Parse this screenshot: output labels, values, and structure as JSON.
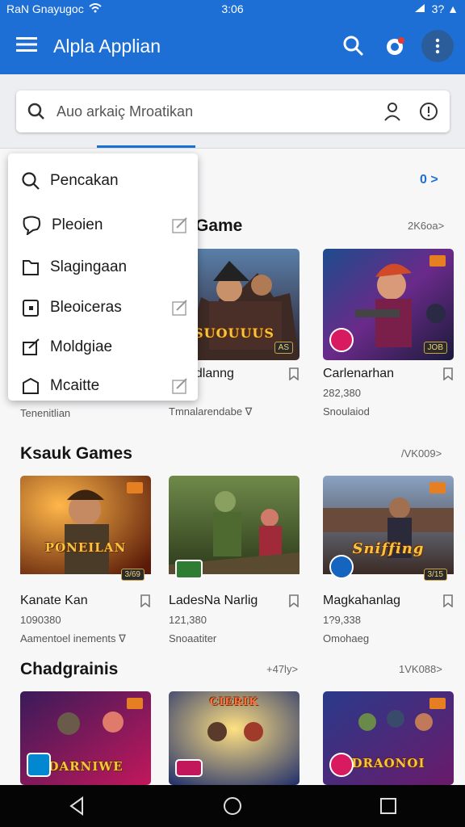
{
  "status_bar": {
    "left_text": "RaN Gnayugoc",
    "time": "3:06",
    "right_text": "3? ▲"
  },
  "app_bar": {
    "title": "Alpla Applian",
    "icons": [
      "menu-icon",
      "search-icon",
      "notification-icon",
      "more-vert-icon"
    ]
  },
  "search": {
    "placeholder": "Auo arkaiç Mroatikan"
  },
  "dropdown": {
    "items": [
      {
        "label": "Pencakan",
        "icon": "search-icon",
        "check": false
      },
      {
        "label": "Pleoien",
        "icon": "chat-icon",
        "check": true
      },
      {
        "label": "Slagingaan",
        "icon": "folder-icon",
        "check": false
      },
      {
        "label": "Bleoiceras",
        "icon": "wallet-icon",
        "check": true
      },
      {
        "label": "Moldgiae",
        "icon": "edit-box-icon",
        "check": false
      },
      {
        "label": "Mcaitte",
        "icon": "tag-icon",
        "check": true
      }
    ]
  },
  "sections": [
    {
      "title": "Game",
      "top_more": "0 >",
      "link": "2K6oa>",
      "cards": [
        {
          "name": "",
          "meta": "",
          "sub": "Tenenitlian",
          "logo": ""
        },
        {
          "name": "Smadlanng",
          "meta": "5ia",
          "sub": "Tmnalarendabe ∇",
          "logo": "SUOUUUS",
          "badge": "AS"
        },
        {
          "name": "Carlenarhan",
          "meta": "282,380",
          "sub": "Snoulaiod",
          "logo": "",
          "badge": "JOB"
        }
      ]
    },
    {
      "title": "Ksauk Games",
      "link": "/VK009>",
      "cards": [
        {
          "name": "Kanate Kan",
          "meta": "1090380",
          "sub": "Aamentoel inements ∇",
          "logo": "PONEILAN",
          "badge": "3/69"
        },
        {
          "name": "LadesNa Narlig",
          "meta": "121,380",
          "sub": "Snoaatiter",
          "logo": "",
          "badge": ""
        },
        {
          "name": "Magkahanlag",
          "meta": "1?9,338",
          "sub": "Omohaeg",
          "logo": "Sniffing",
          "badge": "3/15"
        }
      ]
    },
    {
      "title": "Chadgrainis",
      "link": "+47ly>",
      "link2": "1VK088>",
      "cards": [
        {
          "name": "",
          "logo": "DARNIWE"
        },
        {
          "name": "",
          "logo": "CIERIK"
        },
        {
          "name": "",
          "logo": "DRAONOI"
        }
      ]
    }
  ]
}
